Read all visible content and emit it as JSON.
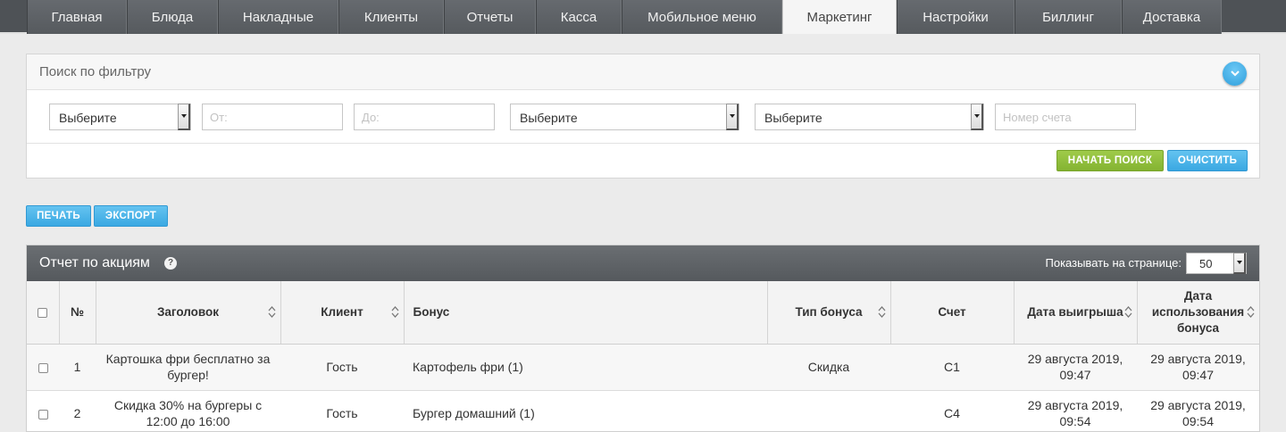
{
  "nav": {
    "tabs": [
      {
        "label": "Главная"
      },
      {
        "label": "Блюда"
      },
      {
        "label": "Накладные"
      },
      {
        "label": "Клиенты"
      },
      {
        "label": "Отчеты"
      },
      {
        "label": "Касса"
      },
      {
        "label": "Мобильное меню"
      },
      {
        "label": "Маркетинг",
        "active": true
      },
      {
        "label": "Настройки"
      },
      {
        "label": "Биллинг"
      },
      {
        "label": "Доставка"
      }
    ]
  },
  "filter": {
    "title": "Поиск по фильтру",
    "select1": "Выберите",
    "from_placeholder": "От:",
    "to_placeholder": "До:",
    "select2": "Выберите",
    "select3": "Выберите",
    "account_placeholder": "Номер счета",
    "search_button": "НАЧАТЬ ПОИСК",
    "clear_button": "ОЧИСТИТЬ"
  },
  "actions": {
    "print_button": "ПЕЧАТЬ",
    "export_button": "ЭКСПОРТ"
  },
  "report": {
    "title": "Отчет по акциям",
    "per_page_label": "Показывать на странице:",
    "per_page_value": "50",
    "columns": {
      "num": "№",
      "title": "Заголовок",
      "client": "Клиент",
      "bonus": "Бонус",
      "bonus_type": "Тип бонуса",
      "account": "Счет",
      "win_date": "Дата выигрыша",
      "use_date": "Дата использования бонуса"
    },
    "rows": [
      {
        "num": "1",
        "title": "Картошка фри бесплатно за бургер!",
        "client": "Гость",
        "bonus": "Картофель фри (1)",
        "bonus_type": "Скидка",
        "account": "C1",
        "win_date": "29 августа 2019, 09:47",
        "use_date": "29 августа 2019, 09:47"
      },
      {
        "num": "2",
        "title": "Скидка 30% на бургеры с 12:00 до 16:00",
        "client": "Гость",
        "bonus": "Бургер домашний (1)",
        "bonus_type": "",
        "account": "C4",
        "win_date": "29 августа 2019, 09:54",
        "use_date": "29 августа 2019, 09:54"
      }
    ]
  },
  "colors": {
    "nav_bg": "#4e5256",
    "accent_blue": "#3aa8e2",
    "accent_green": "#84b331"
  }
}
